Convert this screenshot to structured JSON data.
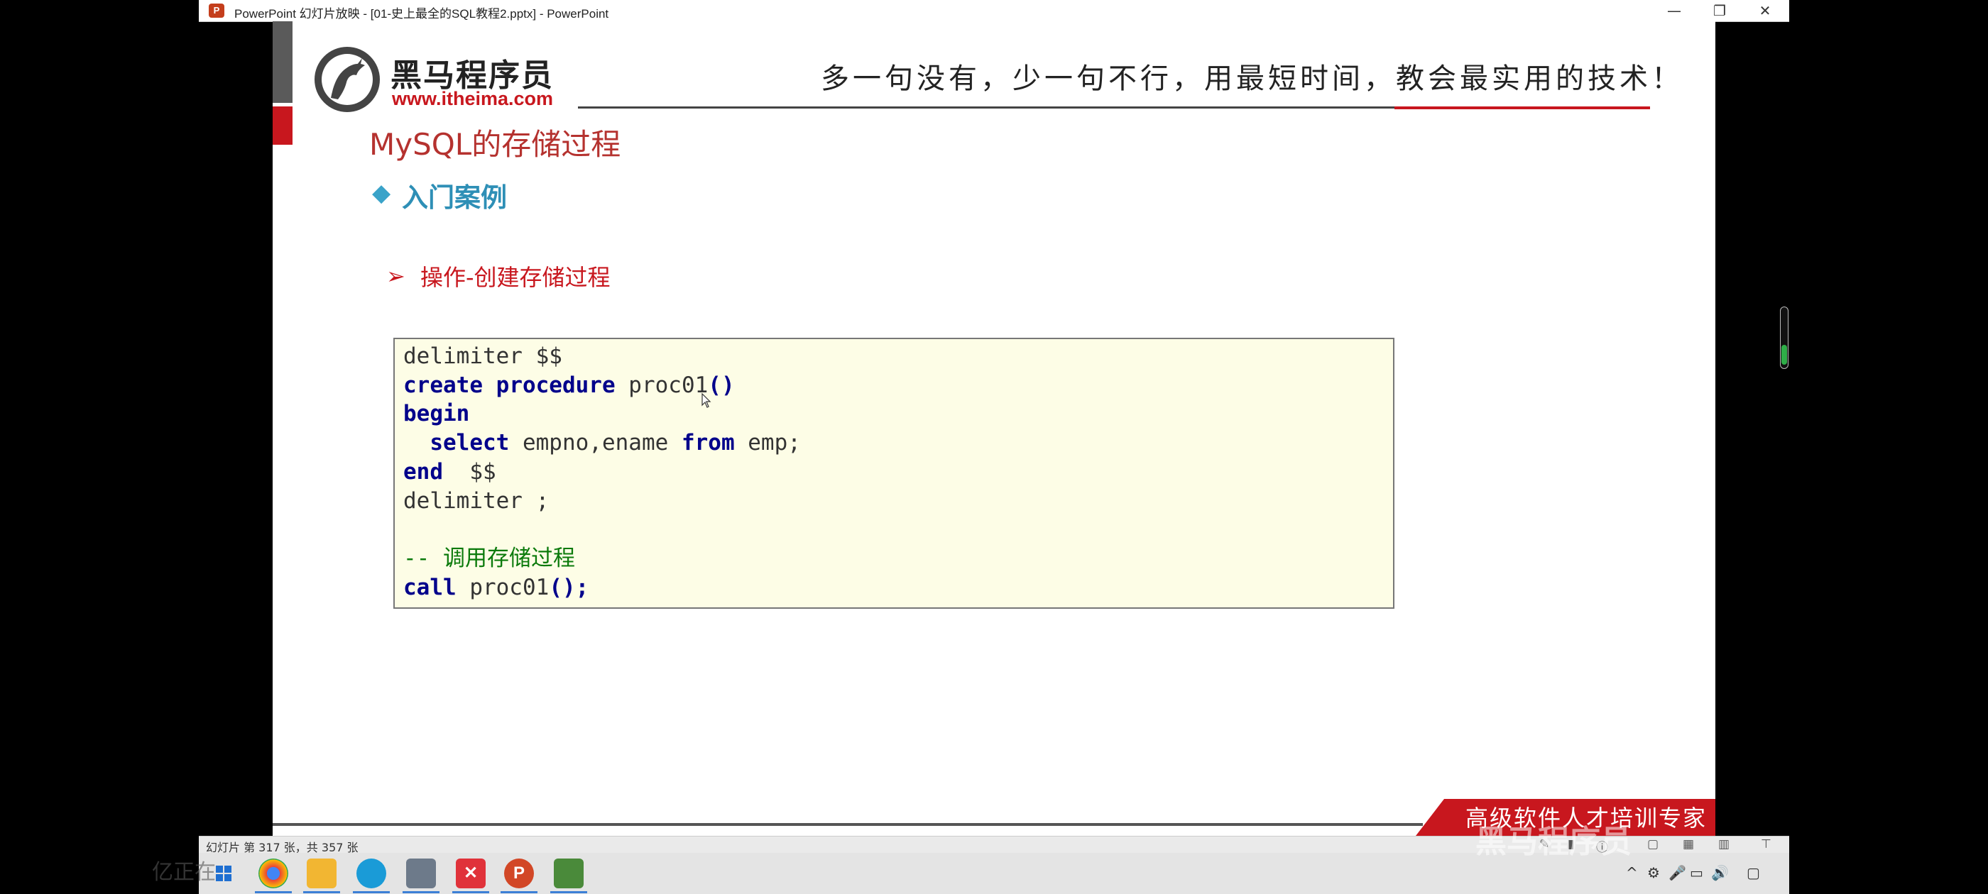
{
  "window": {
    "title": "PowerPoint 幻灯片放映 - [01-史上最全的SQL教程2.pptx] - PowerPoint",
    "app_icon_letter": "P",
    "controls": {
      "minimize": "—",
      "restore": "❐",
      "close": "✕"
    }
  },
  "slide": {
    "brand_cn": "黑马程序员",
    "brand_url": "www.itheima.com",
    "slogan": "多一句没有，少一句不行，用最短时间，教会最实用的技术！",
    "title": "MySQL的存储过程",
    "section_heading": "入门案例",
    "subheading": "操作-创建存储过程",
    "code_lines": [
      [
        {
          "t": "delimiter $$"
        }
      ],
      [
        {
          "t": "create",
          "k": "kw"
        },
        {
          "t": " "
        },
        {
          "t": "procedure",
          "k": "kw"
        },
        {
          "t": " proc01"
        },
        {
          "t": "()",
          "k": "kw"
        }
      ],
      [
        {
          "t": "begin",
          "k": "kw"
        }
      ],
      [
        {
          "t": "  "
        },
        {
          "t": "select",
          "k": "kw"
        },
        {
          "t": " empno,ename "
        },
        {
          "t": "from",
          "k": "kw"
        },
        {
          "t": " emp;"
        }
      ],
      [
        {
          "t": "end",
          "k": "kw"
        },
        {
          "t": "  $$"
        }
      ],
      [
        {
          "t": "delimiter ;"
        }
      ],
      [
        {
          "t": ""
        }
      ],
      [
        {
          "t": "-- 调用存储过程",
          "k": "cm"
        }
      ],
      [
        {
          "t": "call",
          "k": "kw"
        },
        {
          "t": " proc01"
        },
        {
          "t": "();",
          "k": "kw"
        }
      ]
    ],
    "footer_text": "高级软件人才培训专家"
  },
  "statusbar": {
    "slide_count": "幻灯片 第 317 张，共 357 张"
  },
  "taskbar": {
    "icons": [
      "windows-start",
      "chrome",
      "file-explorer",
      "browser",
      "image-viewer",
      "xmind",
      "powerpoint",
      "editor"
    ],
    "tray": [
      "^",
      "⚙",
      "🎤",
      "▭",
      "🔊",
      "▢"
    ]
  },
  "overlays": {
    "left_ghost": "亿正在",
    "watermark": "黑马程序员"
  },
  "colors": {
    "brand_red": "#c8171e",
    "title_red": "#b5322f",
    "heading_blue": "#2e8fb6",
    "code_keyword": "#00008b",
    "code_comment": "#0b7a0b",
    "code_bg": "#fdfde6"
  }
}
